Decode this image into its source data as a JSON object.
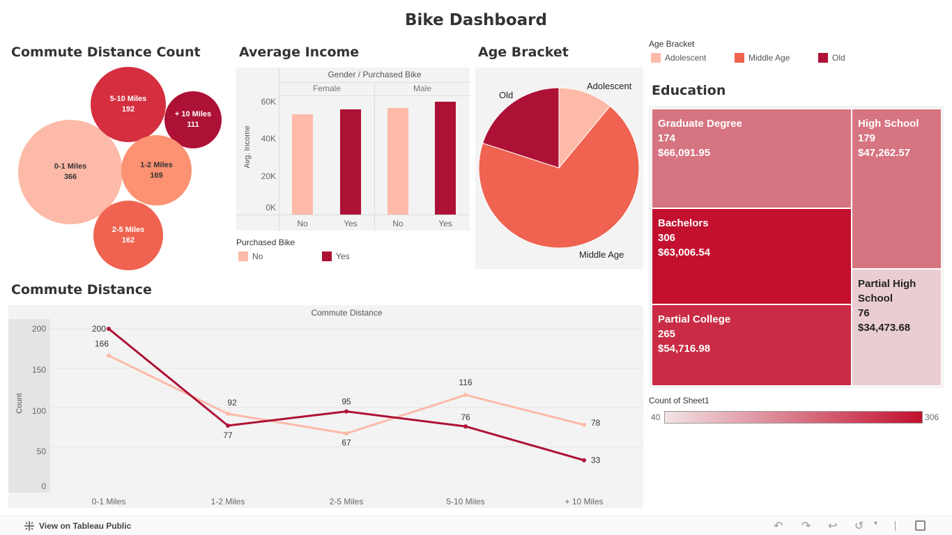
{
  "dashboard_title": "Bike Dashboard",
  "colors": {
    "light": "#fdbaa8",
    "mid": "#ef6350",
    "dark": "#ad1135",
    "red": "#d42e3f",
    "salmon": "#fc9272",
    "no": "#fdbaa8",
    "yes": "#ad1135"
  },
  "commute_count": {
    "title": "Commute Distance Count",
    "bubbles": [
      {
        "label": "0-1 Miles",
        "value": "366"
      },
      {
        "label": "5-10 Miles",
        "value": "192"
      },
      {
        "label": "+ 10 Miles",
        "value": "111"
      },
      {
        "label": "1-2 Miles",
        "value": "169"
      },
      {
        "label": "2-5 Miles",
        "value": "162"
      }
    ]
  },
  "avg_income": {
    "title": "Average Income",
    "header": "Gender / Purchased Bike",
    "genders": [
      "Female",
      "Male"
    ],
    "y_axis_label": "Avg. Income",
    "ticks": [
      "60K",
      "40K",
      "20K",
      "0K"
    ],
    "x_labels": [
      "No",
      "Yes",
      "No",
      "Yes"
    ]
  },
  "purchased_legend": {
    "title": "Purchased Bike",
    "items": [
      "No",
      "Yes"
    ]
  },
  "age_bracket": {
    "title": "Age Bracket",
    "labels": {
      "old": "Old",
      "adolescent": "Adolescent",
      "middle": "Middle Age"
    }
  },
  "age_legend": {
    "title": "Age Bracket",
    "items": [
      "Adolescent",
      "Middle Age",
      "Old"
    ]
  },
  "education": {
    "title": "Education",
    "cells": [
      {
        "name": "Graduate Degree",
        "count": "174",
        "income": "$66,091.95"
      },
      {
        "name": "High School",
        "count": "179",
        "income": "$47,262.57"
      },
      {
        "name": "Bachelors",
        "count": "306",
        "income": "$63,006.54"
      },
      {
        "name": "Partial High",
        "name2": "School",
        "count": "76",
        "income": "$34,473.68"
      },
      {
        "name": "Partial College",
        "count": "265",
        "income": "$54,716.98"
      }
    ]
  },
  "count_legend": {
    "title": "Count of Sheet1",
    "min": "40",
    "max": "306"
  },
  "commute_distance": {
    "title": "Commute Distance",
    "header": "Commute Distance",
    "y_axis_label": "Count",
    "y_ticks": [
      "200",
      "150",
      "100",
      "50",
      "0"
    ]
  },
  "chart_data": [
    {
      "type": "bar",
      "title": "Average Income",
      "categories": [
        "Female / No",
        "Female / Yes",
        "Male / No",
        "Male / Yes"
      ],
      "values": [
        53500,
        56000,
        56500,
        60000
      ],
      "ylabel": "Avg. Income",
      "ylim": [
        0,
        60000
      ]
    },
    {
      "type": "pie",
      "title": "Age Bracket",
      "categories": [
        "Adolescent",
        "Middle Age",
        "Old"
      ],
      "values": [
        11,
        69,
        20
      ]
    },
    {
      "type": "line",
      "title": "Commute Distance",
      "categories": [
        "0-1 Miles",
        "1-2 Miles",
        "2-5 Miles",
        "5-10 Miles",
        "+ 10 Miles"
      ],
      "series": [
        {
          "values": [
            200,
            77,
            95,
            76,
            33
          ]
        },
        {
          "values": [
            166,
            92,
            67,
            116,
            78
          ]
        }
      ],
      "ylabel": "Count",
      "ylim": [
        0,
        200
      ]
    }
  ],
  "footer": {
    "link_label": "View on Tableau Public"
  }
}
